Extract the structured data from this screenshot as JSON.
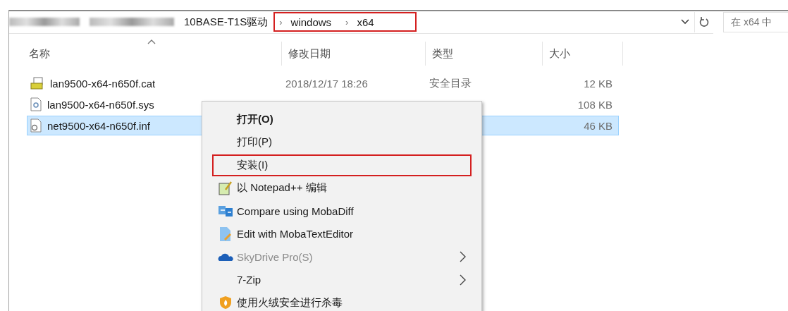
{
  "address_bar": {
    "crumbs": [
      {
        "kind": "blurred"
      },
      {
        "kind": "blurred"
      },
      {
        "kind": "text",
        "text": "10BASE-T1S驱动"
      }
    ],
    "highlighted_crumbs": [
      "windows",
      "x64"
    ],
    "separator": "›"
  },
  "search": {
    "placeholder": "在 x64 中"
  },
  "columns": [
    {
      "label": "名称",
      "sorted": true
    },
    {
      "label": "修改日期",
      "sorted": false
    },
    {
      "label": "类型",
      "sorted": false
    },
    {
      "label": "大小",
      "sorted": false
    }
  ],
  "files": [
    {
      "kind": "catalog",
      "name": "lan9500-x64-n650f.cat",
      "date": "2018/12/17 18:26",
      "type": "安全目录",
      "size": "12 KB",
      "selected": false
    },
    {
      "kind": "system",
      "name": "lan9500-x64-n650f.sys",
      "size": "108 KB",
      "selected": false
    },
    {
      "kind": "settings",
      "name": "net9500-x64-n650f.inf",
      "size": "46 KB",
      "selected": true
    }
  ],
  "context_menu": [
    {
      "kind": "none",
      "label": "打开(O)",
      "bold": true,
      "disabled": false,
      "submenu": false,
      "highlighted": false
    },
    {
      "kind": "none",
      "label": "打印(P)",
      "bold": false,
      "disabled": false,
      "submenu": false,
      "highlighted": false
    },
    {
      "kind": "none",
      "label": "安装(I)",
      "bold": false,
      "disabled": false,
      "submenu": false,
      "highlighted": true
    },
    {
      "kind": "notepad",
      "label": "以 Notepad++ 编辑",
      "bold": false,
      "disabled": false,
      "submenu": false,
      "highlighted": false
    },
    {
      "kind": "compare",
      "label": "Compare using MobaDiff",
      "bold": false,
      "disabled": false,
      "submenu": false,
      "highlighted": false
    },
    {
      "kind": "editor",
      "label": "Edit with MobaTextEditor",
      "bold": false,
      "disabled": false,
      "submenu": false,
      "highlighted": false
    },
    {
      "kind": "cloud",
      "label": "SkyDrive Pro(S)",
      "bold": false,
      "disabled": true,
      "submenu": true,
      "highlighted": false
    },
    {
      "kind": "none",
      "label": "7-Zip",
      "bold": false,
      "disabled": false,
      "submenu": true,
      "highlighted": false
    },
    {
      "kind": "shield",
      "label": "使用火绒安全进行杀毒",
      "bold": false,
      "disabled": false,
      "submenu": false,
      "highlighted": false
    }
  ]
}
